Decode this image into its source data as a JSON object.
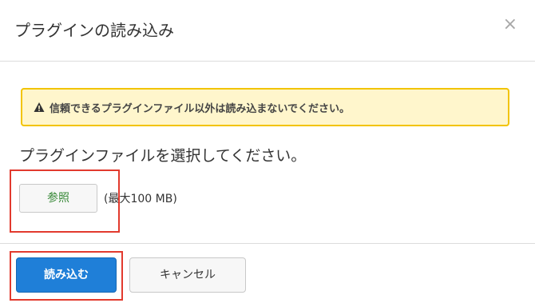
{
  "dialog": {
    "title": "プラグインの読み込み",
    "close_glyph": "×"
  },
  "warning": {
    "text": "信頼できるプラグインファイル以外は読み込まないでください。",
    "icon": "warning-triangle-icon"
  },
  "prompt": "プラグインファイルを選択してください。",
  "file": {
    "browse_label": "参照",
    "size_limit": "(最大100 MB)"
  },
  "actions": {
    "load_label": "読み込む",
    "cancel_label": "キャンセル"
  },
  "colors": {
    "primary": "#1f7fd8",
    "warning_bg": "#fff6cc",
    "warning_border": "#f2c400",
    "highlight": "#e23a2e"
  }
}
